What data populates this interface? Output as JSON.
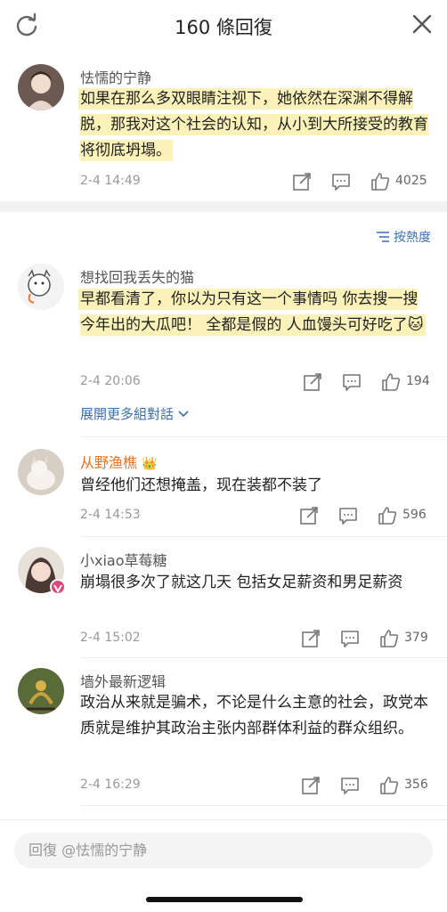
{
  "header": {
    "title": "160 條回復"
  },
  "main_comment": {
    "username": "怯懦的宁静",
    "text": "如果在那么多双眼睛注视下，她依然在深渊不得解脱，那我对这个社会的认知，从小到大所接受的教育将彻底坍塌。",
    "time": "2-4 14:49",
    "likes": "4025"
  },
  "sort": {
    "label": "按熱度"
  },
  "replies": [
    {
      "username": "想找回我丢失的猫",
      "text": "早都看清了，你以为只有这一个事情吗 你去搜一搜今年出的大瓜吧！ 全都是假的 人血馒头可好吃了",
      "emoji": "🐱",
      "time": "2-4 20:06",
      "likes": "194"
    },
    {
      "username": "从野渔樵",
      "text": "曾经他们还想掩盖，现在装都不装了",
      "badge": "👑",
      "time": "2-4 14:53",
      "likes": "596"
    },
    {
      "username": "小xiao草莓糖",
      "text": "崩塌很多次了就这几天 包括女足薪资和男足薪资",
      "time": "2-4 15:02",
      "likes": "379"
    },
    {
      "username": "墙外最新逻辑",
      "text": "政治从来就是骗术，不论是什么主意的社会，政党本质就是维护其政治主张内部群体利益的群众组织。",
      "time": "2-4 16:29",
      "likes": "356"
    }
  ],
  "expand": {
    "label": "展開更多組對話"
  },
  "input": {
    "placeholder": "回復 @怯懦的宁静"
  },
  "colors": {
    "highlight": "#fbf2b9",
    "link": "#3a6fb0",
    "vip_orange": "#e8731f"
  }
}
